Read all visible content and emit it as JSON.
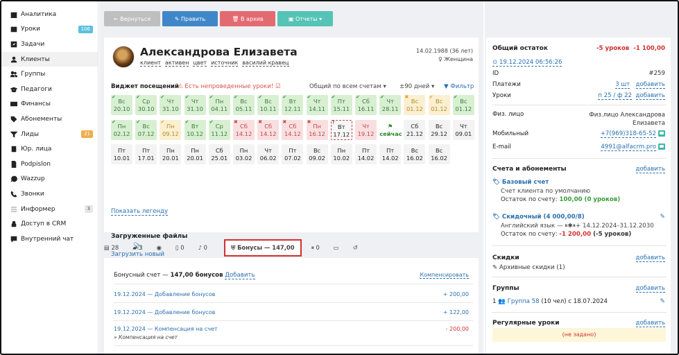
{
  "sidebar": {
    "items": [
      {
        "label": "Аналитика",
        "icon": "book-icon"
      },
      {
        "label": "Уроки",
        "icon": "calendar-icon",
        "badge": "106",
        "badge_color": "#5bc0de"
      },
      {
        "label": "Задачи",
        "icon": "checkbox-icon"
      },
      {
        "label": "Клиенты",
        "icon": "user-icon",
        "active": true
      },
      {
        "label": "Группы",
        "icon": "users-icon"
      },
      {
        "label": "Педагоги",
        "icon": "graduation-cap-icon"
      },
      {
        "label": "Финансы",
        "icon": "money-icon"
      },
      {
        "label": "Абонементы",
        "icon": "tags-icon"
      },
      {
        "label": "Лиды",
        "icon": "filter-icon",
        "badge": "21",
        "badge_color": "#f0ad4e"
      },
      {
        "label": "Юр. лица",
        "icon": "building-icon"
      },
      {
        "label": "Podpislon",
        "icon": "document-icon"
      },
      {
        "label": "Wazzup",
        "icon": "whatsapp-icon"
      },
      {
        "label": "Звонки",
        "icon": "phone-icon"
      },
      {
        "label": "Информер",
        "icon": "list-icon",
        "badge": "3",
        "badge_color": "#e6e6e6"
      },
      {
        "label": "Доступ в CRM",
        "icon": "lock-icon"
      },
      {
        "label": "Внутренний чат",
        "icon": "comment-icon"
      }
    ]
  },
  "toolbar": {
    "back": "← Вернуться",
    "edit": "✎ Править",
    "archive": "🗑 В архив",
    "reports": "▣ Отчеты ▾",
    "colors": {
      "back": "#bfbfbf",
      "edit": "#3f87c8",
      "archive": "#e46a72",
      "reports": "#55c3b6"
    }
  },
  "client": {
    "name": "Александрова Елизавета",
    "tags": [
      "клиент",
      "активен",
      "цвет",
      "источник",
      "василий кравец"
    ],
    "birth": "14.02.1988 (36 лет)",
    "gender": "♀ Женщина"
  },
  "widget": {
    "title": "Виджет посещений",
    "warning": "⚠ Есть непроведенные уроки! ☑",
    "account": "Общий по всем счетам ▾",
    "days": "±90 дней ▾",
    "filter": "▼ Фильтр",
    "legend": "Показать легенду",
    "cells": [
      {
        "d": "Вс",
        "v": "20.10",
        "c": "g",
        "m": "✔"
      },
      {
        "d": "Ср",
        "v": "30.10",
        "c": "g",
        "m": "✔"
      },
      {
        "d": "Чт",
        "v": "31.10",
        "c": "g",
        "m": "✔"
      },
      {
        "d": "Чт",
        "v": "31.10",
        "c": "g",
        "m": "✔"
      },
      {
        "d": "Пн",
        "v": "04.11",
        "c": "g",
        "m": "✔"
      },
      {
        "d": "Вс",
        "v": "05.11",
        "c": "g",
        "m": "✔"
      },
      {
        "d": "Вс",
        "v": "10.11",
        "c": "g",
        "m": "✔"
      },
      {
        "d": "Вт",
        "v": "12.11",
        "c": "g",
        "m": "✔"
      },
      {
        "d": "Чт",
        "v": "14.11",
        "c": "g",
        "m": "✔"
      },
      {
        "d": "Пт",
        "v": "15.11",
        "c": "g",
        "m": "✔"
      },
      {
        "d": "Сб",
        "v": "16.11",
        "c": "g",
        "m": "✔"
      },
      {
        "d": "Чт",
        "v": "28.11",
        "c": "g",
        "m": "✔"
      },
      {
        "d": "Вс",
        "v": "01.12",
        "c": "o",
        "m": "✖"
      },
      {
        "d": "Вс",
        "v": "01.12",
        "c": "o",
        "m": "✔"
      },
      {
        "d": "Вс",
        "v": "01.12",
        "c": "g",
        "m": "✔"
      },
      {
        "d": "Пн",
        "v": "02.12",
        "c": "g",
        "m": "✔"
      },
      {
        "d": "Вс",
        "v": "07.12",
        "c": "g",
        "m": "✔"
      },
      {
        "d": "Пн",
        "v": "09.12",
        "c": "o",
        "m": "✔"
      },
      {
        "d": "Вт",
        "v": "10.12",
        "c": "g",
        "m": "✔"
      },
      {
        "d": "Ср",
        "v": "11.12",
        "c": "g",
        "m": "✔"
      },
      {
        "d": "Сб",
        "v": "14.12",
        "c": "r",
        "m": "✖"
      },
      {
        "d": "Сб",
        "v": "14.12",
        "c": "r",
        "m": "✖"
      },
      {
        "d": "Сб",
        "v": "14.12",
        "c": "r",
        "m": "✖"
      },
      {
        "d": "Пн",
        "v": "16.12",
        "c": "r",
        "m": "✖"
      },
      {
        "d": "Вт",
        "v": "17.12",
        "c": "cur",
        "m": "?"
      },
      {
        "d": "Чт",
        "v": "19.12",
        "c": "r",
        "m": ""
      },
      {
        "d": "",
        "v": "сейчас",
        "c": "now",
        "m": ""
      },
      {
        "d": "Сб",
        "v": "21.12",
        "c": "n",
        "m": ""
      },
      {
        "d": "Вс",
        "v": "29.12",
        "c": "n",
        "m": ""
      },
      {
        "d": "Чт",
        "v": "09.01",
        "c": "n",
        "m": ""
      },
      {
        "d": "Пт",
        "v": "10.01",
        "c": "n",
        "m": ""
      },
      {
        "d": "Пт",
        "v": "17.01",
        "c": "n",
        "m": ""
      },
      {
        "d": "Пн",
        "v": "20.01",
        "c": "n",
        "m": ""
      },
      {
        "d": "Пн",
        "v": "20.01",
        "c": "n",
        "m": ""
      },
      {
        "d": "Сб",
        "v": "25.01",
        "c": "n",
        "m": ""
      },
      {
        "d": "Пн",
        "v": "03.02",
        "c": "n",
        "m": ""
      },
      {
        "d": "Чт",
        "v": "06.02",
        "c": "n",
        "m": ""
      },
      {
        "d": "Пт",
        "v": "07.02",
        "c": "n",
        "m": ""
      },
      {
        "d": "Вс",
        "v": "09.02",
        "c": "n",
        "m": ""
      },
      {
        "d": "Пн",
        "v": "10.02",
        "c": "n",
        "m": ""
      },
      {
        "d": "Пт",
        "v": "14.02",
        "c": "n",
        "m": ""
      },
      {
        "d": "Пт",
        "v": "14.02",
        "c": "n",
        "m": ""
      },
      {
        "d": "Вс",
        "v": "16.02",
        "c": "n",
        "m": ""
      },
      {
        "d": "Вс",
        "v": "16.02",
        "c": "n",
        "m": ""
      }
    ]
  },
  "files": {
    "title": "Загруженные файлы",
    "upload": "Загрузить новый"
  },
  "tabs": [
    {
      "label": "▤ 28"
    },
    {
      "label": "▰ 3"
    },
    {
      "label": "◉"
    },
    {
      "label": "▯ 0"
    },
    {
      "label": "♪ 0"
    },
    {
      "label": "⛨ Бонусы — 147,00",
      "active": true
    },
    {
      "label": "⏸ 0"
    },
    {
      "label": "▭"
    },
    {
      "label": "↺"
    }
  ],
  "bonus": {
    "header_text": "Бонусный счет — ",
    "header_amount": "147,00 бонусов",
    "add": "Добавить",
    "compensate": "Компенсировать",
    "rows": [
      {
        "label": "19.12.2024 — Добавление бонусов",
        "amount": "+ 200,00",
        "color": "#2a6fb0"
      },
      {
        "label": "19.12.2024 — Добавление бонусов",
        "amount": "+ 122,00",
        "color": "#2a6fb0"
      },
      {
        "label": "19.12.2024 — Компенсация на счет",
        "amount": "- 200,00",
        "color": "#d32f2f",
        "note": "» Компенсация на счет"
      }
    ]
  },
  "right": {
    "title": "Общий остаток",
    "balance_lessons": "-5 уроков",
    "balance_money": "-1 100,00",
    "timestamp": "⊙ 19.12.2024 06:56:26",
    "id_label": "ID",
    "id_value": "#259",
    "payments_label": "Платежи",
    "payments_value": "3 шт",
    "payments_add": "добавить",
    "lessons_label": "Уроки",
    "lessons_value": "п 25 / ф 22",
    "lessons_add": "добавить",
    "person_label": "Физ. лицо",
    "person_value_1": "Физ.лицо Александрова",
    "person_value_2": "Елизавета",
    "mobile_label": "Мобильный",
    "mobile_value": "+7(969)318-65-52",
    "email_label": "E-mail",
    "email_value": "4991@alfacrm.pro",
    "accounts_title": "Счета и абонементы",
    "accounts_add": "добавить",
    "base_name": "🏷 Базовый счет",
    "base_desc": "Счет клиента по умолчанию",
    "base_rest_label": "Остаток по счету: ",
    "base_rest_value": "100,00 (0 уроков)",
    "disc_name": "🏷 Скидочный (4 000,00/8)",
    "disc_desc": "Английский язык — ⏸✱⏸+  14.12.2024–31.12.2030",
    "disc_rest_label": "Остаток по счету: ",
    "disc_rest_value": "-1 200,00",
    "disc_rest_suffix": " (-5 уроков)",
    "discounts_title": "Скидки",
    "discounts_add": "добавить",
    "archive_discounts": "✎ Архивные скидки (1)",
    "groups_title": "Группы",
    "groups_add": "добавить",
    "group_line_prefix": "1 👥 ",
    "group_line": "Группа 58",
    "group_line_suffix": " (10 чел) с 18.07.2024",
    "regular_title": "Регулярные уроки",
    "regular_add": "добавить",
    "regular_empty": "(не задано)"
  }
}
